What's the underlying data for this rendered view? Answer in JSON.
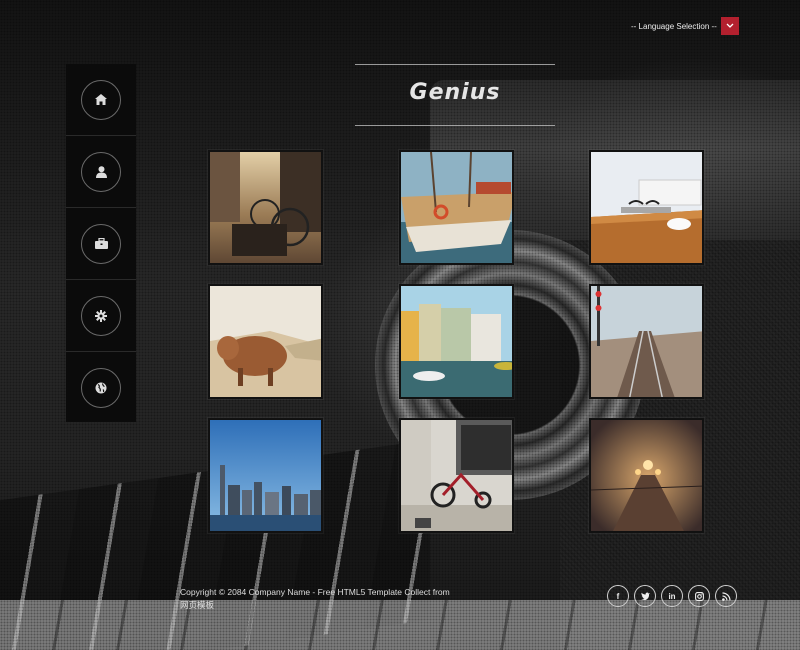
{
  "header": {
    "language_label": "-- Language Selection --",
    "logo_text": "Genius"
  },
  "sidebar": {
    "items": [
      {
        "icon": "home-icon"
      },
      {
        "icon": "user-icon"
      },
      {
        "icon": "briefcase-icon"
      },
      {
        "icon": "gear-icon"
      },
      {
        "icon": "globe-icon"
      }
    ]
  },
  "gallery": {
    "items": [
      {
        "subject": "street-bicycles"
      },
      {
        "subject": "harbor-boat"
      },
      {
        "subject": "desk-glasses"
      },
      {
        "subject": "highland-cow"
      },
      {
        "subject": "canal-houses"
      },
      {
        "subject": "railway-tracks"
      },
      {
        "subject": "city-skyline"
      },
      {
        "subject": "red-tricycle"
      },
      {
        "subject": "foggy-train"
      }
    ]
  },
  "footer": {
    "copyright": "Copyright © 2084 Company Name - Free HTML5 Template Collect from 网页模板",
    "social": [
      {
        "label": "f",
        "icon": "facebook-icon"
      },
      {
        "label": "t",
        "icon": "twitter-icon"
      },
      {
        "label": "in",
        "icon": "linkedin-icon"
      },
      {
        "label": "ig",
        "icon": "instagram-icon"
      },
      {
        "label": "rss",
        "icon": "rss-icon"
      }
    ]
  },
  "colors": {
    "accent": "#b3202e",
    "sidebar_bg": "#0b0b0b"
  }
}
